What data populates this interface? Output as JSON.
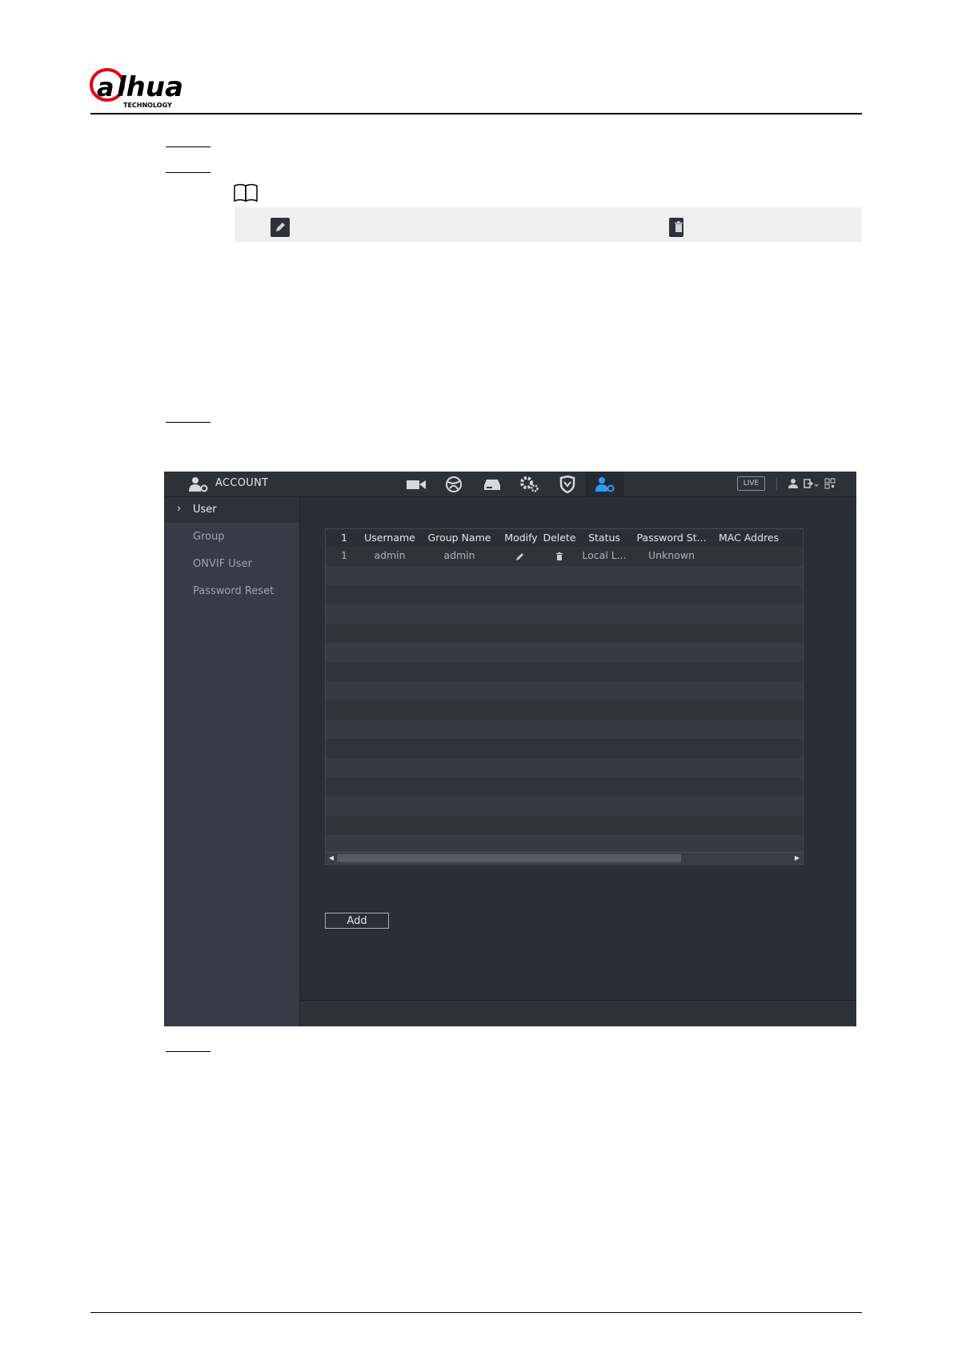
{
  "brand": {
    "logo_text": "alhua",
    "logo_sub": "TECHNOLOGY",
    "accent": "#e60012"
  },
  "ui": {
    "section_title": "ACCOUNT",
    "nav_icons": [
      "camera-icon",
      "network-globe-icon",
      "storage-icon",
      "system-settings-icon",
      "security-shield-icon",
      "account-icon"
    ],
    "live_badge": "LIVE",
    "sidebar": {
      "items": [
        {
          "label": "User",
          "active": true
        },
        {
          "label": "Group",
          "active": false
        },
        {
          "label": "ONVIF User",
          "active": false
        },
        {
          "label": "Password Reset",
          "active": false
        }
      ]
    },
    "table": {
      "columns": [
        "1",
        "Username",
        "Group Name",
        "Modify",
        "Delete",
        "Status",
        "Password St...",
        "MAC Addres"
      ],
      "rows": [
        {
          "no": "1",
          "username": "admin",
          "group": "admin",
          "status": "Local L...",
          "password_strength": "Unknown",
          "mac": ""
        }
      ]
    },
    "add_button": "Add",
    "colors": {
      "panel_bg": "#2b2e36",
      "sidebar_bg": "#383b45",
      "active_icon": "#2f9bff"
    }
  }
}
